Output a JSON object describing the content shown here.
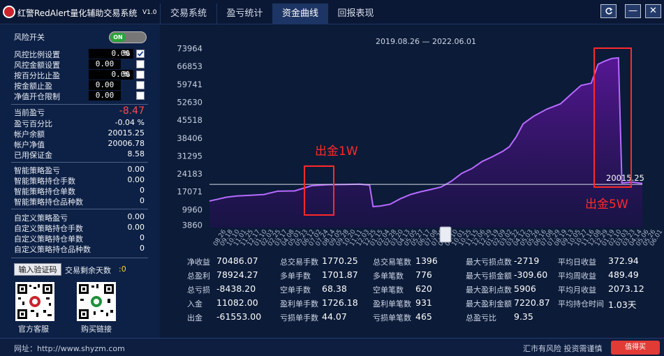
{
  "titlebar": {
    "app_title": "红警RedAlert量化辅助交易系统",
    "version": "V1.0",
    "tabs": [
      {
        "label": "交易系统"
      },
      {
        "label": "盈亏统计"
      },
      {
        "label": "资金曲线"
      },
      {
        "label": "回报表现"
      }
    ],
    "active_tab": "资金曲线",
    "minimize_label": "—",
    "close_label": "✕"
  },
  "risk": {
    "switch_label": "风险开关",
    "switch_state": "ON",
    "rows": [
      {
        "label": "风控比例设置",
        "value": "0.00",
        "unit": "%",
        "checked": true
      },
      {
        "label": "风控金额设置",
        "value": "0.00",
        "unit": "",
        "checked": false
      },
      {
        "label": "按百分比止盈",
        "value": "0.00",
        "unit": "%",
        "checked": false
      },
      {
        "label": "按金额止盈",
        "value": "0.00",
        "unit": "",
        "checked": false
      },
      {
        "label": "净值开仓限制",
        "value": "0.00",
        "unit": "",
        "checked": false
      }
    ]
  },
  "account": [
    {
      "label": "当前盈亏",
      "value": "-8.47"
    },
    {
      "label": "盈亏百分比",
      "value": "-0.04 %"
    },
    {
      "label": "帐户余额",
      "value": "20015.25"
    },
    {
      "label": "帐户净值",
      "value": "20006.78"
    },
    {
      "label": "已用保证金",
      "value": "8.58"
    }
  ],
  "smart_strategy": [
    {
      "label": "智能策略盈亏",
      "value": "0.00"
    },
    {
      "label": "智能策略持仓手数",
      "value": "0.00"
    },
    {
      "label": "智能策略持仓单数",
      "value": "0"
    },
    {
      "label": "智能策略持仓品种数",
      "value": "0"
    }
  ],
  "custom_strategy": [
    {
      "label": "自定义策略盈亏",
      "value": "0.00"
    },
    {
      "label": "自定义策略持仓手数",
      "value": "0.00"
    },
    {
      "label": "自定义策略持仓单数",
      "value": "0"
    },
    {
      "label": "自定义策略持仓品种数",
      "value": "0"
    }
  ],
  "verify": {
    "button_label": "输入验证码",
    "remaining_label": "交易剩余天数",
    "remaining_value": ":0"
  },
  "qr": [
    {
      "caption": "官方客服"
    },
    {
      "caption": "购买链接"
    }
  ],
  "chart_data": {
    "type": "area",
    "title": "2019.08.26 — 2022.06.01",
    "y_ticks": [
      3860,
      9960,
      17071,
      24183,
      31295,
      38406,
      45518,
      52630,
      59741,
      66853,
      73964
    ],
    "ylim": [
      2850,
      75500
    ],
    "x_tick_labels": [
      "08.26",
      "09.18",
      "10.10",
      "11.01",
      "11.25",
      "12.17",
      "01.10",
      "02.03",
      "02.25",
      "03.17",
      "04.08",
      "05.01",
      "05.23",
      "06.12",
      "07.02",
      "07.24",
      "08.14",
      "09.05",
      "09.28",
      "10.20",
      "11.11",
      "12.03",
      "12.25",
      "01.15",
      "02.04",
      "02.28",
      "03.20",
      "04.13",
      "05.05",
      "05.27",
      "06.17",
      "07.08",
      "07.29",
      "08.19",
      "09.10",
      "10.01",
      "10.25",
      "11.15",
      "12.06",
      "12.29",
      "01.19",
      "02.09",
      "03.02",
      "03.22",
      "04.12",
      "05.03",
      "05.26",
      "06.16",
      "07.08",
      "07.29",
      "08.19",
      "09.13",
      "10.05",
      "10.27",
      "11.16",
      "12.08",
      "12.29",
      "01.19",
      "02.10",
      "03.03",
      "03.23",
      "04.14",
      "05.06",
      "05.26",
      "06.01"
    ],
    "equity_points": [
      [
        0,
        13400
      ],
      [
        0.02,
        14000
      ],
      [
        0.05,
        14900
      ],
      [
        0.08,
        15400
      ],
      [
        0.12,
        15700
      ],
      [
        0.16,
        16000
      ],
      [
        0.2,
        17300
      ],
      [
        0.25,
        17400
      ],
      [
        0.3,
        19500
      ],
      [
        0.35,
        19900
      ],
      [
        0.4,
        20000
      ],
      [
        0.44,
        20100
      ],
      [
        0.47,
        19700
      ],
      [
        0.48,
        11200
      ],
      [
        0.5,
        11400
      ],
      [
        0.53,
        12100
      ],
      [
        0.56,
        14300
      ],
      [
        0.59,
        16000
      ],
      [
        0.62,
        17100
      ],
      [
        0.65,
        18000
      ],
      [
        0.68,
        19000
      ],
      [
        0.71,
        21300
      ],
      [
        0.74,
        24400
      ],
      [
        0.77,
        26300
      ],
      [
        0.8,
        29100
      ],
      [
        0.83,
        31000
      ],
      [
        0.86,
        33100
      ],
      [
        0.88,
        35000
      ],
      [
        0.9,
        38900
      ],
      [
        0.92,
        44000
      ],
      [
        0.95,
        47000
      ],
      [
        0.99,
        49900
      ],
      [
        1.03,
        52000
      ],
      [
        1.06,
        55700
      ],
      [
        1.09,
        59300
      ],
      [
        1.12,
        60200
      ],
      [
        1.14,
        67700
      ],
      [
        1.16,
        69000
      ],
      [
        1.18,
        70000
      ],
      [
        1.2,
        70300
      ],
      [
        1.21,
        20600
      ],
      [
        1.24,
        20900
      ],
      [
        1.27,
        20400
      ]
    ],
    "current_value_label": "20015.25",
    "current_value": 20015.25
  },
  "annotations": [
    {
      "text": "出金1W"
    },
    {
      "text": "出金5W"
    }
  ],
  "stats": [
    [
      {
        "label": "净收益",
        "value": "70486.07"
      },
      {
        "label": "总盈利",
        "value": "78924.27"
      },
      {
        "label": "总亏损",
        "value": "-8438.20"
      },
      {
        "label": "入金",
        "value": "11082.00"
      },
      {
        "label": "出金",
        "value": "-61553.00"
      }
    ],
    [
      {
        "label": "总交易手数",
        "value": "1770.25"
      },
      {
        "label": "多单手数",
        "value": "1701.87"
      },
      {
        "label": "空单手数",
        "value": "68.38"
      },
      {
        "label": "盈利单手数",
        "value": "1726.18"
      },
      {
        "label": "亏损单手数",
        "value": "44.07"
      }
    ],
    [
      {
        "label": "总交易笔数",
        "value": "1396"
      },
      {
        "label": "多单笔数",
        "value": "776"
      },
      {
        "label": "空单笔数",
        "value": "620"
      },
      {
        "label": "盈利单笔数",
        "value": "931"
      },
      {
        "label": "亏损单笔数",
        "value": "465"
      }
    ],
    [
      {
        "label": "最大亏损点数",
        "value": "-2719"
      },
      {
        "label": "最大亏损金额",
        "value": "-309.60"
      },
      {
        "label": "最大盈利点数",
        "value": "5906"
      },
      {
        "label": "最大盈利金额",
        "value": "7220.87"
      },
      {
        "label": "总盈亏比",
        "value": "9.35"
      }
    ],
    [
      {
        "label": "平均日收益",
        "value": "372.94"
      },
      {
        "label": "平均周收益",
        "value": "489.49"
      },
      {
        "label": "平均月收益",
        "value": "2073.12"
      },
      {
        "label": "平均持仓时间",
        "value": "1.03天"
      }
    ]
  ],
  "footer": {
    "url": "网址：http://www.shyzm.com",
    "risk": "汇市有风险  投资需谨慎",
    "watermark": "值得买"
  },
  "colors": {
    "accent_purple": "#b14dff",
    "loss_red": "#ff4a4a",
    "annotation_red": "#ff2a2a"
  }
}
